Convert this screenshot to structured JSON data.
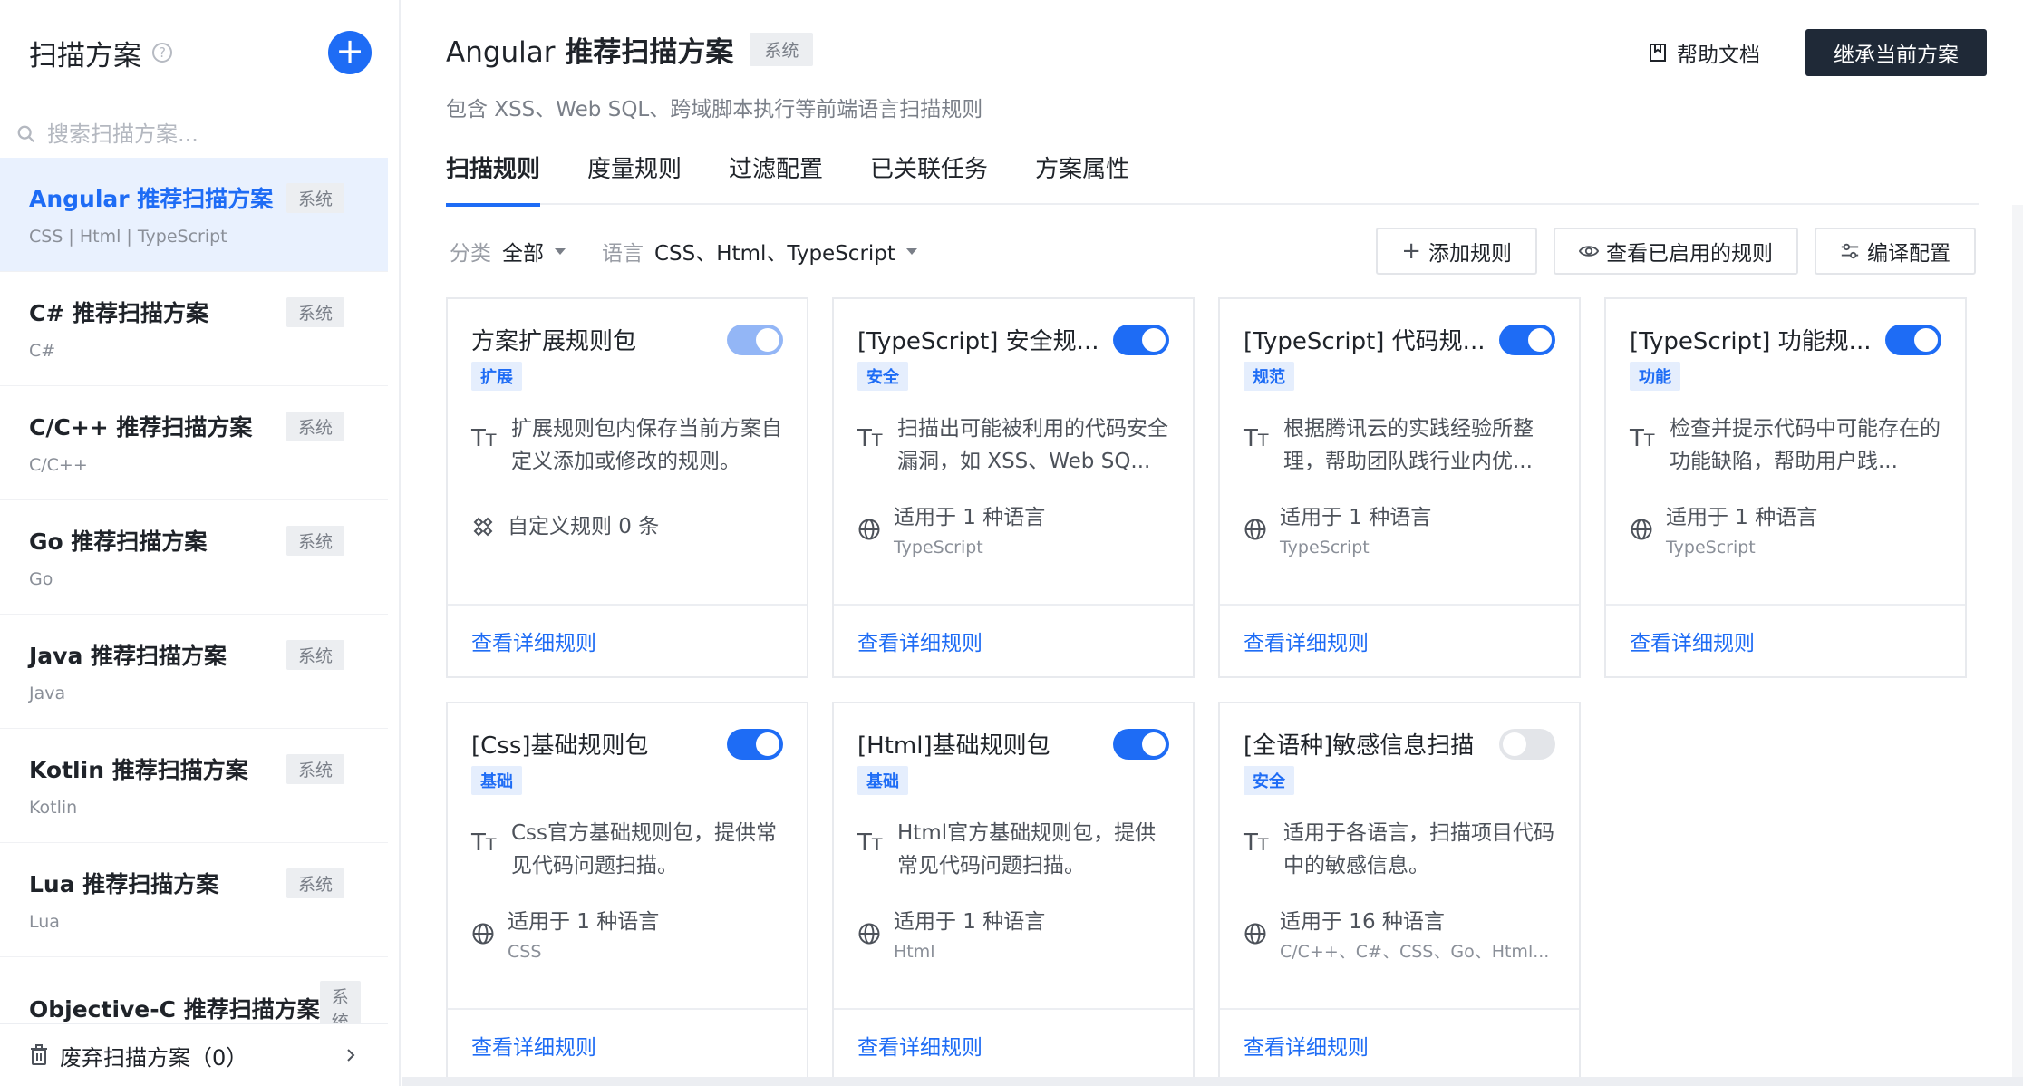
{
  "sidebar": {
    "title": "扫描方案",
    "search_placeholder": "搜索扫描方案...",
    "items": [
      {
        "name": "Angular 推荐扫描方案",
        "tag": "系统",
        "langs": "CSS | Html | TypeScript"
      },
      {
        "name": "C# 推荐扫描方案",
        "tag": "系统",
        "langs": "C#"
      },
      {
        "name": "C/C++ 推荐扫描方案",
        "tag": "系统",
        "langs": "C/C++"
      },
      {
        "name": "Go 推荐扫描方案",
        "tag": "系统",
        "langs": "Go"
      },
      {
        "name": "Java 推荐扫描方案",
        "tag": "系统",
        "langs": "Java"
      },
      {
        "name": "Kotlin 推荐扫描方案",
        "tag": "系统",
        "langs": "Kotlin"
      },
      {
        "name": "Lua 推荐扫描方案",
        "tag": "系统",
        "langs": "Lua"
      },
      {
        "name": "Objective-C 推荐扫描方案",
        "tag": "系统",
        "langs": ""
      }
    ],
    "footer_label": "废弃扫描方案（0）"
  },
  "header": {
    "title_prefix": "Angular",
    "title_suffix": "推荐扫描方案",
    "tag": "系统",
    "description": "包含 XSS、Web SQL、跨域脚本执行等前端语言扫描规则",
    "help_doc": "帮助文档",
    "inherit_button": "继承当前方案"
  },
  "tabs": [
    {
      "label": "扫描规则",
      "active": true
    },
    {
      "label": "度量规则"
    },
    {
      "label": "过滤配置"
    },
    {
      "label": "已关联任务"
    },
    {
      "label": "方案属性"
    }
  ],
  "filters": {
    "category_label": "分类",
    "category_value": "全部",
    "language_label": "语言",
    "language_value": "CSS、Html、TypeScript"
  },
  "actions": {
    "add_rule": "添加规则",
    "view_enabled": "查看已启用的规则",
    "compile_config": "编译配置"
  },
  "cards": [
    {
      "title": "方案扩展规则包",
      "tag": "扩展",
      "toggle": "on-light",
      "desc": "扩展规则包内保存当前方案自定义添加或修改的规则。",
      "meta_main": "自定义规则 0 条",
      "meta_sub": "",
      "meta_icon": "puzzle",
      "link": "查看详细规则"
    },
    {
      "title": "[TypeScript] 安全规...",
      "tag": "安全",
      "toggle": "on",
      "desc": "扫描出可能被利用的代码安全漏洞，如 XSS、Web SQ...",
      "meta_main": "适用于 1 种语言",
      "meta_sub": "TypeScript",
      "meta_icon": "globe",
      "link": "查看详细规则"
    },
    {
      "title": "[TypeScript] 代码规...",
      "tag": "规范",
      "toggle": "on",
      "desc": "根据腾讯云的实践经验所整理，帮助团队践行业内优...",
      "meta_main": "适用于 1 种语言",
      "meta_sub": "TypeScript",
      "meta_icon": "globe",
      "link": "查看详细规则"
    },
    {
      "title": "[TypeScript] 功能规...",
      "tag": "功能",
      "toggle": "on",
      "desc": "检查并提示代码中可能存在的功能缺陷，帮助用户践...",
      "meta_main": "适用于 1 种语言",
      "meta_sub": "TypeScript",
      "meta_icon": "globe",
      "link": "查看详细规则"
    },
    {
      "title": "[Css]基础规则包",
      "tag": "基础",
      "toggle": "on",
      "desc": "Css官方基础规则包，提供常见代码问题扫描。",
      "meta_main": "适用于 1 种语言",
      "meta_sub": "CSS",
      "meta_icon": "globe",
      "link": "查看详细规则"
    },
    {
      "title": "[Html]基础规则包",
      "tag": "基础",
      "toggle": "on",
      "desc": "Html官方基础规则包，提供常见代码问题扫描。",
      "meta_main": "适用于 1 种语言",
      "meta_sub": "Html",
      "meta_icon": "globe",
      "link": "查看详细规则"
    },
    {
      "title": "[全语种]敏感信息扫描",
      "tag": "安全",
      "toggle": "off",
      "desc": "适用于各语言，扫描项目代码中的敏感信息。",
      "meta_main": "适用于 16 种语言",
      "meta_sub": "C/C++、C#、CSS、Go、Html...",
      "meta_icon": "globe",
      "link": "查看详细规则"
    }
  ],
  "colors": {
    "accent": "#1e6cf5",
    "dark_button": "#1f2937",
    "active_bg": "#e9f1fe"
  }
}
